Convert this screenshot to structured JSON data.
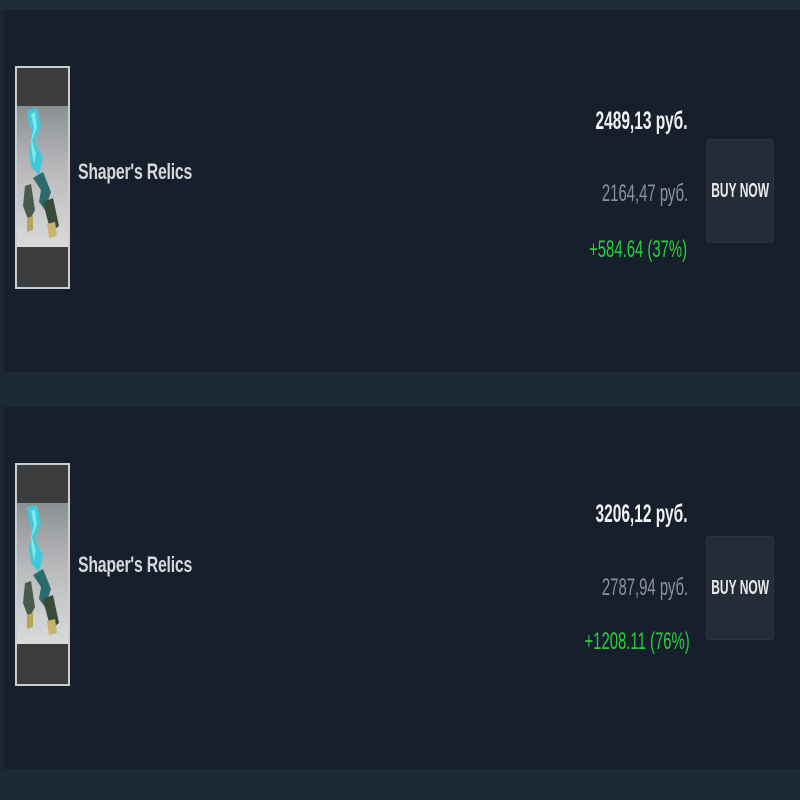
{
  "listings": [
    {
      "item_name": "Shaper's Relics",
      "price": "2489,13 руб.",
      "old_price": "2164,47 руб.",
      "difference": "+584.64 (37%)",
      "buy_label": "BUY NOW",
      "icon": "relic-item-icon"
    },
    {
      "item_name": "Shaper's Relics",
      "price": "3206,12 руб.",
      "old_price": "2787,94 руб.",
      "difference": "+1208.11 (76%)",
      "buy_label": "BUY NOW",
      "icon": "relic-item-icon"
    }
  ],
  "colors": {
    "background": "#1b2633",
    "card": "#161f2b",
    "gain": "#27d13a",
    "muted": "#8a929b",
    "button": "#242d37"
  }
}
